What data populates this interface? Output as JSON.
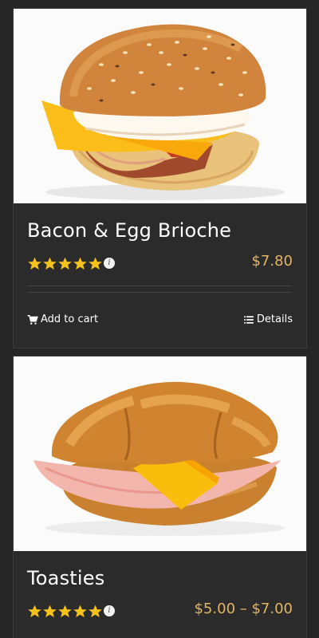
{
  "products": [
    {
      "name": "Bacon & Egg Brioche",
      "rating": 5,
      "rating_max": 5,
      "price": "$7.80",
      "add_to_cart_label": "Add to cart",
      "details_label": "Details",
      "icons": {
        "star": "star-icon",
        "info": "info-icon",
        "cart": "cart-icon",
        "details": "list-icon"
      }
    },
    {
      "name": "Toasties",
      "rating": 5,
      "rating_max": 5,
      "price": "$5.00 – $7.00"
    }
  ],
  "colors": {
    "background": "#262626",
    "card": "#2b2b2b",
    "price": "#e3b567",
    "star": "#f4c21a"
  }
}
